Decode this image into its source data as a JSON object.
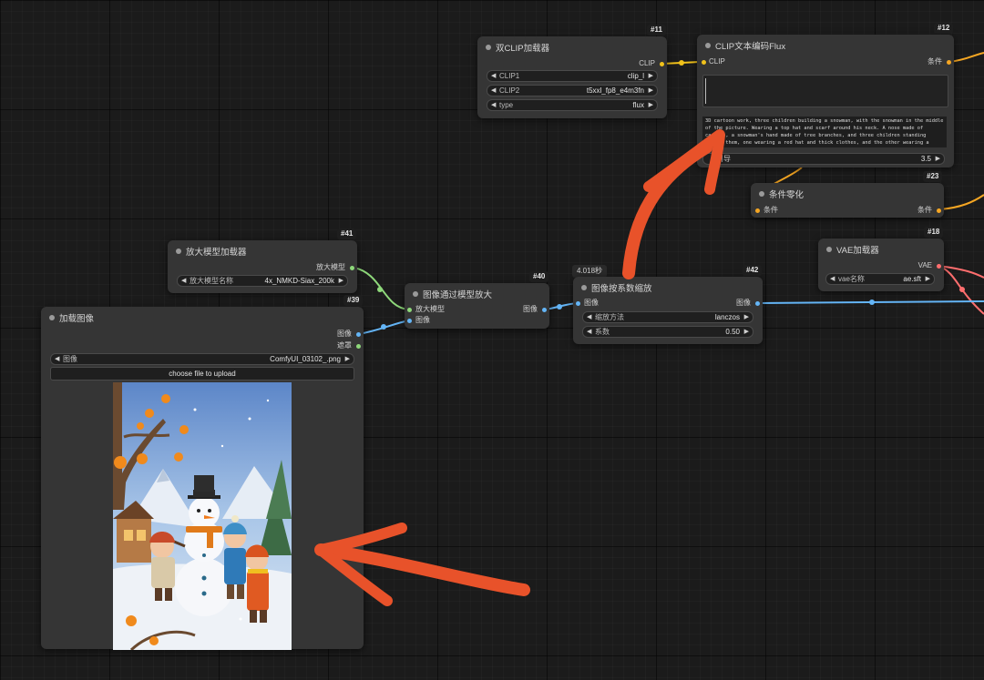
{
  "nodes": {
    "dual_clip": {
      "title": "双CLIP加载器",
      "id": "#11",
      "output": "CLIP",
      "widgets": [
        {
          "label": "CLIP1",
          "value": "clip_l"
        },
        {
          "label": "CLIP2",
          "value": "t5xxl_fp8_e4m3fn"
        },
        {
          "label": "type",
          "value": "flux"
        }
      ]
    },
    "clip_text": {
      "title": "CLIP文本编码Flux",
      "id": "#12",
      "input": "CLIP",
      "output": "条件",
      "prompt": "3D cartoon work, three children building a snowman, with the snowman in the middle of the picture. Wearing a top hat and scarf around his neck. A nose made of carrots, a snowman's hand made of tree branches, and three children standing beside them, one wearing a red hat and thick clothes, and the other wearing a",
      "guidance_label": "引导",
      "guidance_value": "3.5"
    },
    "cond_zero": {
      "title": "条件零化",
      "id": "#23",
      "input": "条件",
      "output": "条件"
    },
    "vae": {
      "title": "VAE加载器",
      "id": "#18",
      "output": "VAE",
      "widget_label": "vae名称",
      "widget_value": "ae.sft"
    },
    "upscale_loader": {
      "title": "放大模型加载器",
      "id": "#41",
      "output": "放大模型",
      "widget_label": "放大模型名称",
      "widget_value": "4x_NMKD-Siax_200k"
    },
    "upscale_with_model": {
      "title": "图像通过模型放大",
      "id": "#40",
      "inputs": [
        "放大模型",
        "图像"
      ],
      "output": "图像"
    },
    "scale_by": {
      "title": "图像按系数缩放",
      "id": "#42",
      "time": "4.018秒",
      "input": "图像",
      "output": "图像",
      "widgets": [
        {
          "label": "缩放方法",
          "value": "lanczos"
        },
        {
          "label": "系数",
          "value": "0.50"
        }
      ]
    },
    "load_image": {
      "title": "加载图像",
      "id": "#39",
      "outputs": [
        "图像",
        "遮罩"
      ],
      "widget_label": "图像",
      "widget_value": "ComfyUI_03102_.png",
      "upload_label": "choose file to upload"
    }
  },
  "colors": {
    "clip": "#f1c21b",
    "conditioning": "#f5a623",
    "vae": "#ff6e6e",
    "image": "#64b5f6",
    "upscale_model": "#8ed87a",
    "annotation_arrow": "#e8522a"
  }
}
